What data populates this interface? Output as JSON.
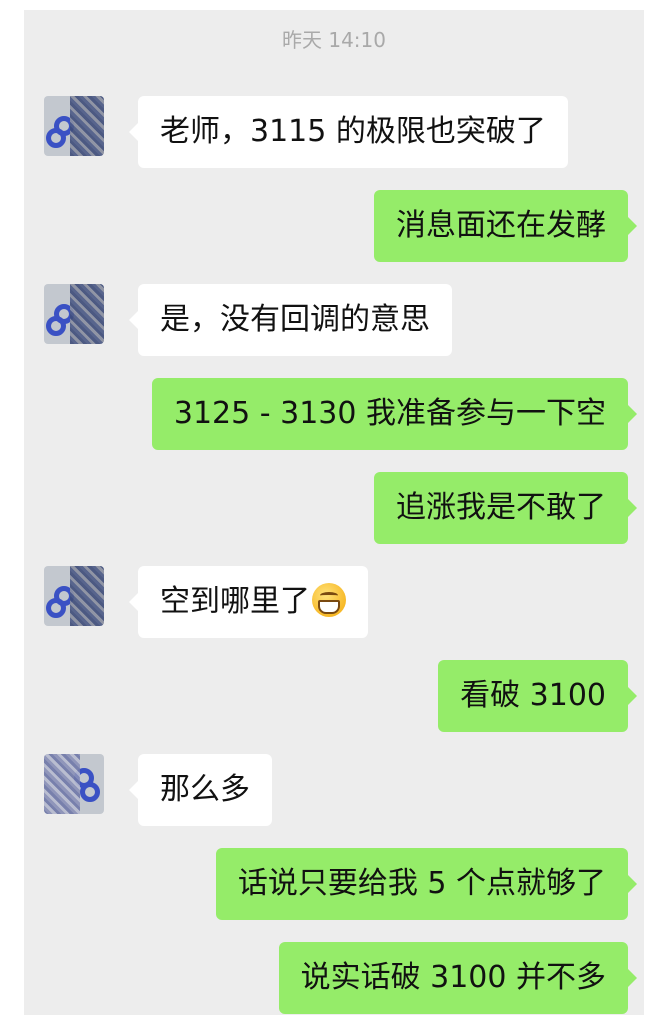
{
  "chat": {
    "timestamp": "昨天 14:10",
    "messages": [
      {
        "side": "in",
        "text": "老师，3115 的极限也突破了"
      },
      {
        "side": "out",
        "text": "消息面还在发酵"
      },
      {
        "side": "in",
        "text": "是，没有回调的意思"
      },
      {
        "side": "out",
        "text": "3125 - 3130 我准备参与一下空"
      },
      {
        "side": "out",
        "text": "追涨我是不敢了"
      },
      {
        "side": "in",
        "text": "空到哪里了",
        "emoji": "grinning-face-emoji"
      },
      {
        "side": "out",
        "text": "看破 3100"
      },
      {
        "side": "in",
        "text": "那么多"
      },
      {
        "side": "out",
        "text": "话说只要给我 5 个点就够了"
      },
      {
        "side": "out",
        "text": "说实话破 3100 并不多"
      }
    ]
  },
  "colors": {
    "background": "#ededed",
    "incoming_bubble": "#ffffff",
    "outgoing_bubble": "#95ec69",
    "timestamp_text": "#a9a9a9"
  }
}
